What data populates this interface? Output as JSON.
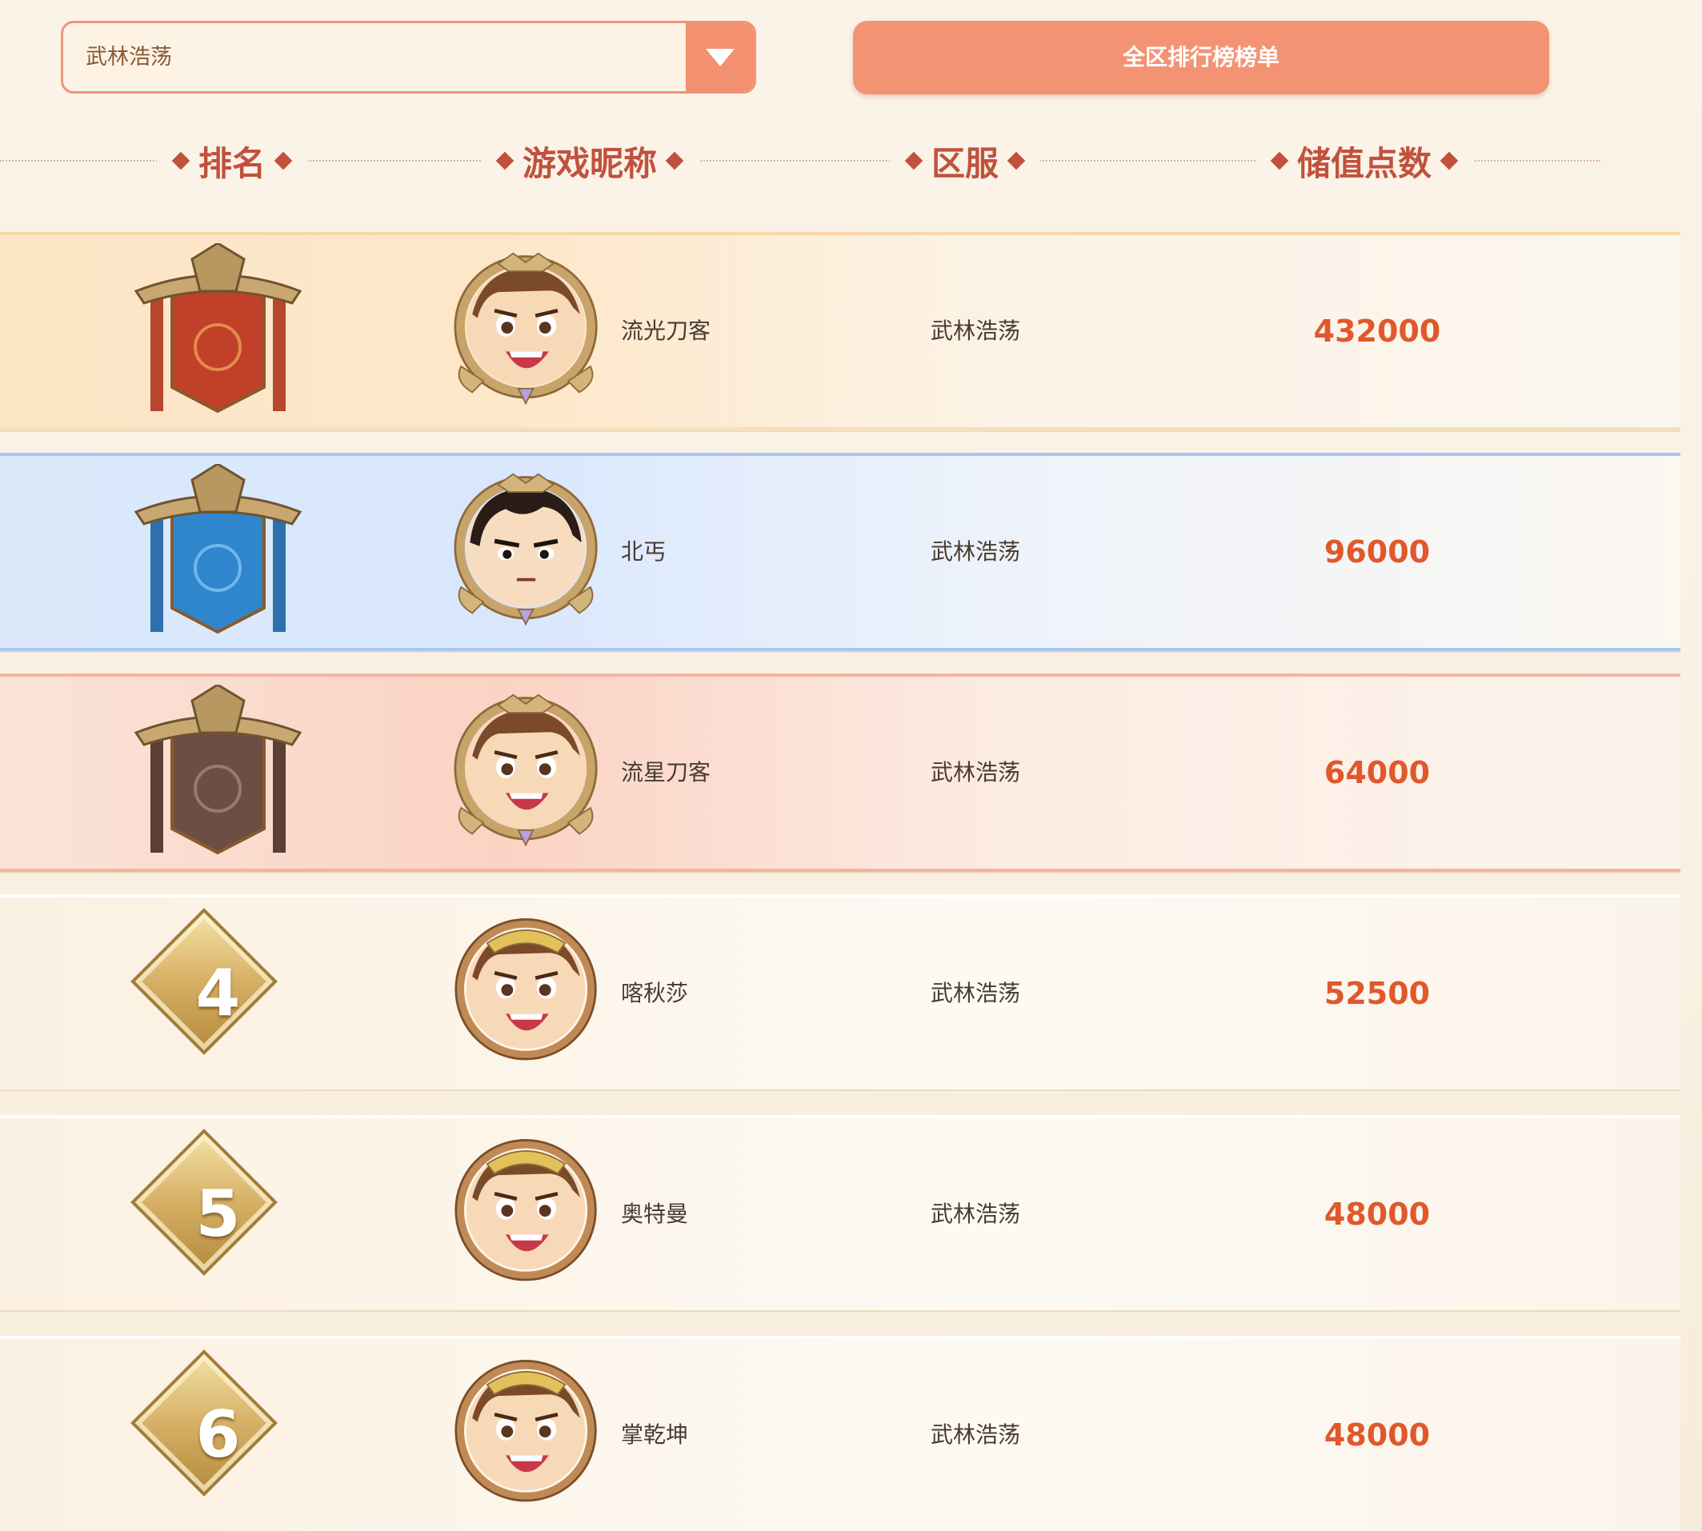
{
  "filter": {
    "server_value": "武林浩荡",
    "all_rank_button": "全区排行榜榜单"
  },
  "table": {
    "headers": [
      "排名",
      "游戏昵称",
      "区服",
      "储值点数"
    ],
    "rows": [
      {
        "rank": "1",
        "badge": "red-banner",
        "nickname": "流光刀客",
        "server": "武林浩荡",
        "points": "432000"
      },
      {
        "rank": "2",
        "badge": "blue-banner",
        "nickname": "北丐",
        "server": "武林浩荡",
        "points": "96000"
      },
      {
        "rank": "3",
        "badge": "brown-banner",
        "nickname": "流星刀客",
        "server": "武林浩荡",
        "points": "64000"
      },
      {
        "rank": "4",
        "badge": "gold-diamond",
        "nickname": "喀秋莎",
        "server": "武林浩荡",
        "points": "52500"
      },
      {
        "rank": "5",
        "badge": "gold-diamond",
        "nickname": "奥特曼",
        "server": "武林浩荡",
        "points": "48000"
      },
      {
        "rank": "6",
        "badge": "gold-diamond",
        "nickname": "掌乾坤",
        "server": "武林浩荡",
        "points": "48000"
      }
    ]
  },
  "colors": {
    "accent": "#f3906f",
    "points": "#e0582b",
    "header_text": "#c0523d",
    "banner_red": "#c0402a",
    "banner_blue": "#2f86cc",
    "banner_brown": "#6d4e44"
  }
}
